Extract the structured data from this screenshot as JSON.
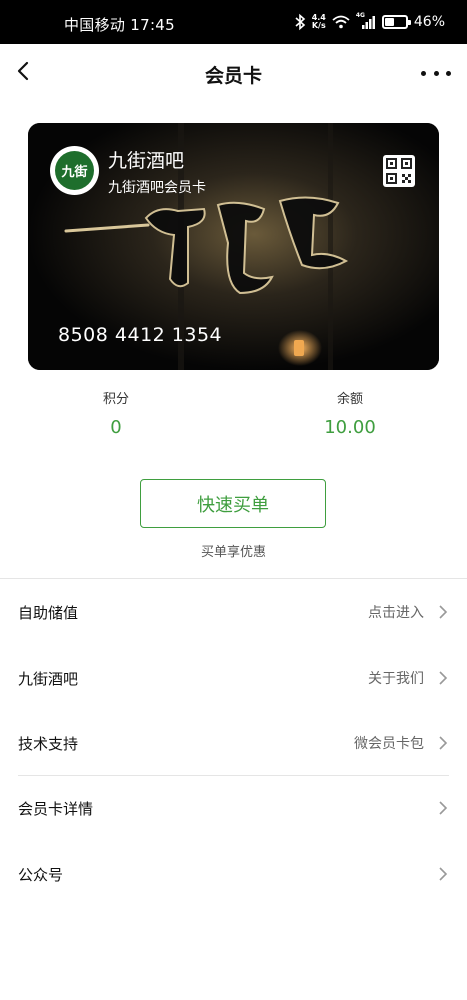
{
  "status_bar": {
    "carrier": "中国移动 17:45",
    "net_speed": "4.4",
    "net_speed_unit": "K/s",
    "signal_type": "4G",
    "battery": "46%",
    "battery_level": 0.46
  },
  "navbar": {
    "title": "会员卡"
  },
  "card": {
    "logo_text": "九街",
    "merchant_name": "九街酒吧",
    "card_name": "九街酒吧会员卡",
    "card_number": "8508 4412 1354"
  },
  "stats": {
    "points_label": "积分",
    "points_value": "0",
    "balance_label": "余额",
    "balance_value": "10.00"
  },
  "quick_pay": {
    "button_label": "快速买单",
    "note": "买单享优惠"
  },
  "menu": {
    "items": [
      {
        "label": "自助储值",
        "value": "点击进入"
      },
      {
        "label": "九街酒吧",
        "value": "关于我们"
      },
      {
        "label": "技术支持",
        "value": "微会员卡包"
      },
      {
        "label": "会员卡详情",
        "value": ""
      },
      {
        "label": "公众号",
        "value": ""
      }
    ]
  },
  "colors": {
    "accent_green": "#3f9e3f",
    "status_bar_bg": "#000000"
  }
}
